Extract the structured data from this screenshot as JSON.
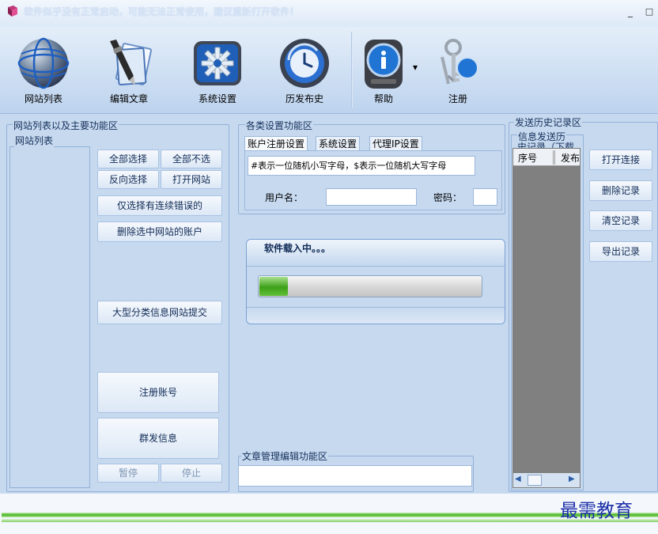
{
  "window": {
    "title": "软件似乎没有正常启动，可能无法正常使用，建议重新打开软件！",
    "controls": {
      "minimize": "_",
      "maximize": "□"
    }
  },
  "toolbar": [
    {
      "label": "网站列表",
      "icon": "globe-icon"
    },
    {
      "label": "编辑文章",
      "icon": "pen-document-icon"
    },
    {
      "label": "系统设置",
      "icon": "gear-icon"
    },
    {
      "label": "历发布史",
      "icon": "clock-history-icon"
    },
    {
      "label": "帮助",
      "icon": "info-help-icon",
      "dropdown": "▾"
    },
    {
      "label": "注册",
      "icon": "keys-icon"
    }
  ],
  "left_panel": {
    "group_title": "网站列表以及主要功能区",
    "list_title": "网站列表",
    "buttons": {
      "select_all": "全部选择",
      "select_none": "全部不选",
      "invert": "反向选择",
      "open_site": "打开网站",
      "only_errors": "仅选择有连续错误的",
      "delete_accounts": "删除选中网站的账户",
      "large_submit": "大型分类信息网站提交",
      "register": "注册账号",
      "broadcast": "群发信息",
      "pause": "暂停",
      "stop": "停止"
    }
  },
  "middle_panel": {
    "group_title": "各类设置功能区",
    "tabs": [
      "账户注册设置",
      "系统设置",
      "代理IP设置"
    ],
    "hint_text": "#表示一位随机小写字母，$表示一位随机大写字母",
    "username_label": "用户名：",
    "password_label": "密码：",
    "username_value": "",
    "password_value": "",
    "article_group_title": "文章管理编辑功能区"
  },
  "loading": {
    "text": "软件载入中。。。",
    "progress": 0.13
  },
  "right_panel": {
    "group_title": "发送历史记录区",
    "sub_title_1": "信息发送历",
    "sub_title_2": "史记录（下载",
    "columns": [
      "序号",
      "发布"
    ],
    "buttons": {
      "open_connection": "打开连接",
      "delete_record": "删除记录",
      "clear_record": "清空记录",
      "export_record": "导出记录"
    },
    "scroll_left": "◀",
    "scroll_right": "▶"
  },
  "watermark": "最需教育",
  "colors": {
    "background": "#c6d9ef",
    "accent_blue": "#1b2fa8",
    "progress_green": "#3da018"
  }
}
